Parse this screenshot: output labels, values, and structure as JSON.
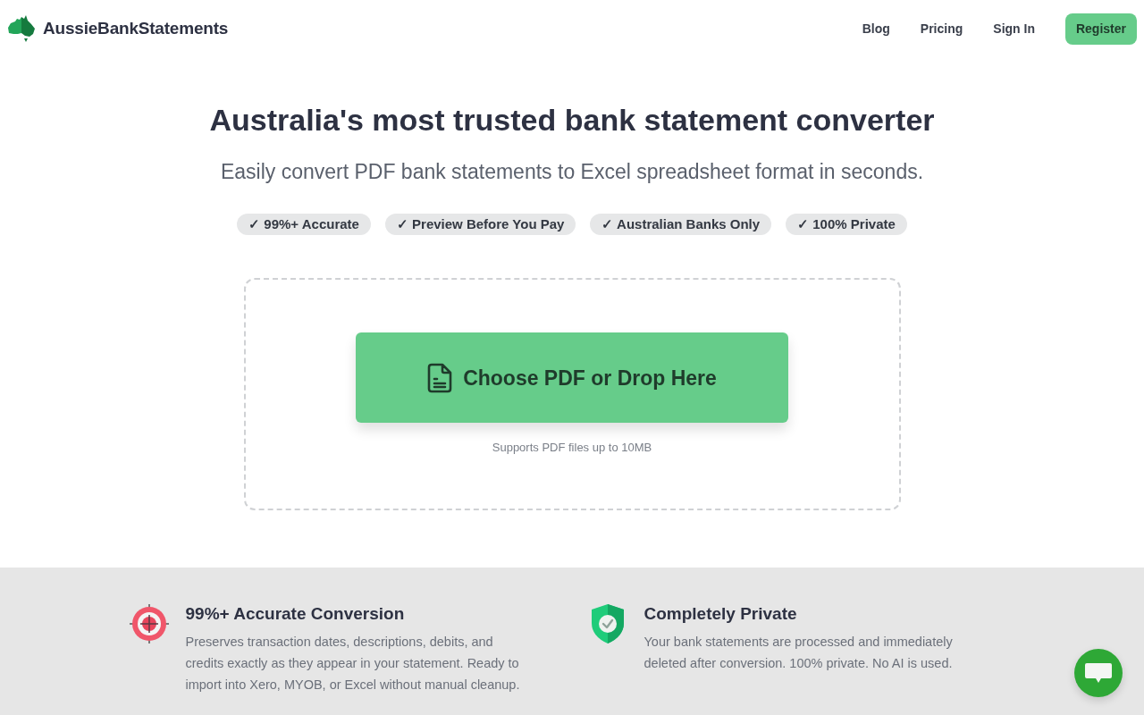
{
  "nav": {
    "brand": "AussieBankStatements",
    "links": [
      {
        "label": "Blog",
        "kind": "link"
      },
      {
        "label": "Pricing",
        "kind": "link"
      },
      {
        "label": "Sign In",
        "kind": "link"
      },
      {
        "label": "Register",
        "kind": "button"
      }
    ]
  },
  "hero": {
    "title": "Australia's most trusted bank statement converter",
    "subtitle": "Easily convert PDF bank statements to Excel spreadsheet format in seconds.",
    "badges": [
      "✓ 99%+ Accurate",
      "✓ Preview Before You Pay",
      "✓ Australian Banks Only",
      "✓ 100% Private"
    ]
  },
  "upload": {
    "button": "Choose PDF or Drop Here",
    "hint": "Supports PDF files up to 10MB"
  },
  "features": [
    {
      "kind": "target",
      "title": "99%+ Accurate Conversion",
      "text": "Preserves transaction dates, descriptions, debits, and credits exactly as they appear in your statement. Ready to import into Xero, MYOB, or Excel without manual cleanup."
    },
    {
      "kind": "shield",
      "title": "Completely Private",
      "text": "Your bank statements are processed and immediately deleted after conversion. 100% private. No AI is used."
    }
  ]
}
